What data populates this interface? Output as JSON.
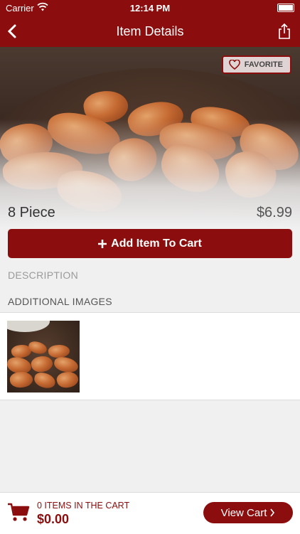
{
  "status": {
    "carrier": "Carrier",
    "time": "12:14 PM"
  },
  "nav": {
    "title": "Item Details"
  },
  "item": {
    "favorite_label": "FAVORITE",
    "name": "8 Piece",
    "price": "$6.99",
    "add_label": "Add Item To Cart"
  },
  "sections": {
    "description": "DESCRIPTION",
    "additional_images": "ADDITIONAL IMAGES"
  },
  "footer": {
    "items_in_cart": "0 ITEMS IN THE CART",
    "total": "$0.00",
    "view_cart": "View Cart"
  },
  "colors": {
    "brand": "#8c0d0d",
    "background": "#f0f0f0"
  }
}
